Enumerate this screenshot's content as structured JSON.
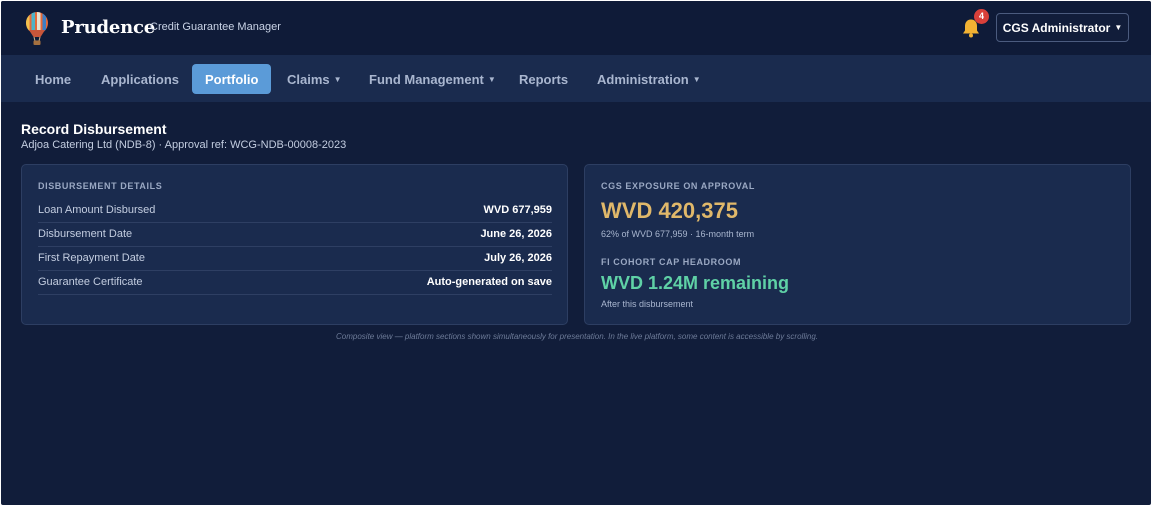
{
  "header": {
    "brand": "Prudence",
    "subtitle": "Credit Guarantee Manager",
    "notification_count": "4",
    "user_menu_label": "CGS Administrator"
  },
  "nav": {
    "items": [
      {
        "label": "Home",
        "has_dropdown": false,
        "active": false
      },
      {
        "label": "Applications",
        "has_dropdown": false,
        "active": false
      },
      {
        "label": "Portfolio",
        "has_dropdown": false,
        "active": true
      },
      {
        "label": "Claims",
        "has_dropdown": true,
        "active": false
      },
      {
        "label": "Fund Management",
        "has_dropdown": true,
        "active": false
      },
      {
        "label": "Reports",
        "has_dropdown": false,
        "active": false
      },
      {
        "label": "Administration",
        "has_dropdown": true,
        "active": false
      }
    ]
  },
  "page": {
    "title": "Record Disbursement",
    "subtitle": "Adjoa Catering Ltd (NDB-8) · Approval ref: WCG-NDB-00008-2023"
  },
  "disbursement": {
    "heading": "DISBURSEMENT DETAILS",
    "rows": [
      {
        "label": "Loan Amount Disbursed",
        "value": "WVD 677,959"
      },
      {
        "label": "Disbursement Date",
        "value": "June 26, 2026"
      },
      {
        "label": "First Repayment Date",
        "value": "July 26, 2026"
      },
      {
        "label": "Guarantee Certificate",
        "value": "Auto-generated on save"
      }
    ]
  },
  "exposure": {
    "heading": "CGS EXPOSURE ON APPROVAL",
    "value": "WVD 420,375",
    "note": "62% of WVD 677,959 · 16-month term",
    "headroom_heading": "FI COHORT CAP HEADROOM",
    "headroom_value": "WVD 1.24M remaining",
    "headroom_note": "After this disbursement"
  },
  "footnote": "Composite view — platform sections shown simultaneously for presentation. In the live platform, some content is accessible by scrolling.",
  "icons": {
    "logo": "hot-air-balloon-icon",
    "notifications": "bell-icon",
    "dropdown": "caret-down-icon"
  },
  "colors": {
    "background": "#111d3a",
    "nav_background": "#1a2b4e",
    "active_tab": "#5b9bd8",
    "exposure_accent": "#e0b86a",
    "headroom_accent": "#5fd1a6",
    "badge": "#d9403a",
    "bell": "#f2b233"
  }
}
